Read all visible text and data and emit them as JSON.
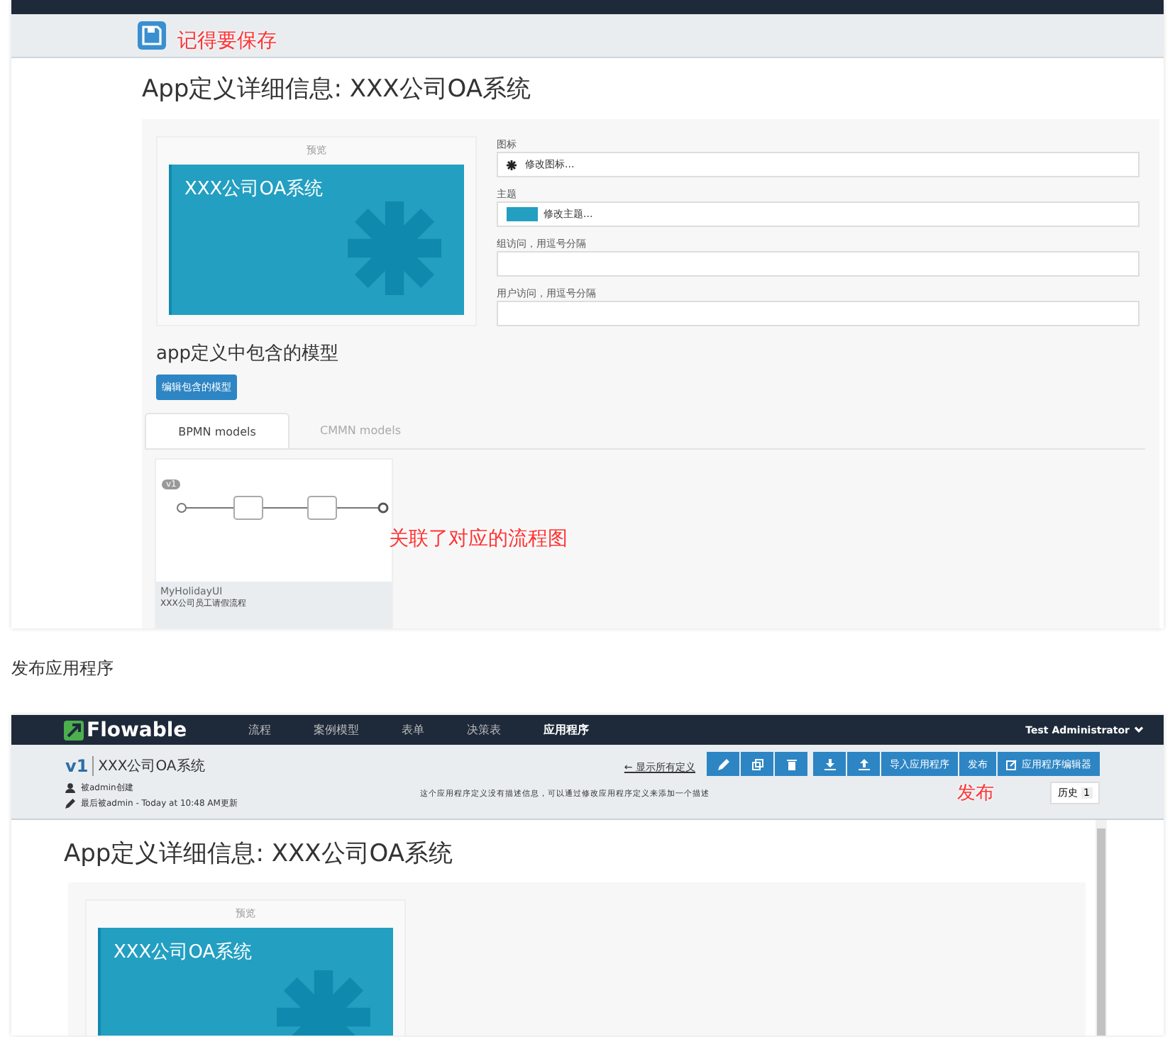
{
  "screenshot_1": {
    "save_note": "记得要保存",
    "title": "App定义详细信息: XXX公司OA系统",
    "preview": {
      "label": "预览",
      "app_name": "XXX公司OA系统"
    },
    "form": [
      {
        "label": "图标",
        "value": "修改图标...",
        "kind": "icon"
      },
      {
        "label": "主题",
        "value": "修改主题...",
        "kind": "theme"
      },
      {
        "label": "组访问，用逗号分隔",
        "kind": "text"
      },
      {
        "label": "用户访问，用逗号分隔",
        "kind": "text"
      }
    ],
    "models_heading": "app定义中包含的模型",
    "edit_button": "编辑包含的模型",
    "tabs": [
      {
        "label": "BPMN models",
        "selected": true
      },
      {
        "label": "CMMN models",
        "selected": false
      }
    ],
    "model_card": {
      "version": "v1",
      "name": "MyHolidayUI",
      "description": "XXX公司员工请假流程"
    },
    "note": "关联了对应的流程图"
  },
  "paragraph": "发布应用程序",
  "screenshot_2": {
    "logo": "Flowable",
    "nav": [
      {
        "label": "流程",
        "selected": false
      },
      {
        "label": "案例模型",
        "selected": false
      },
      {
        "label": "表单",
        "selected": false
      },
      {
        "label": "决策表",
        "selected": false
      },
      {
        "label": "应用程序",
        "selected": true
      }
    ],
    "user": "Test Administrator",
    "version": "v1",
    "app_name": "XXX公司OA系统",
    "back_link": "← 显示所有定义",
    "text_buttons": [
      "导入应用程序",
      "发布",
      "应用程序编辑器"
    ],
    "created": "被admin创建",
    "updated": "最后被admin - Today at 10:48 AM更新",
    "description": "这个应用程序定义没有描述信息，可以通过修改应用程序定义来添加一个描述",
    "note": "发布",
    "history": {
      "label": "历史",
      "count": "1"
    },
    "title": "App定义详细信息: XXX公司OA系统",
    "preview": {
      "label": "预览",
      "app_name": "XXX公司OA系统"
    }
  }
}
